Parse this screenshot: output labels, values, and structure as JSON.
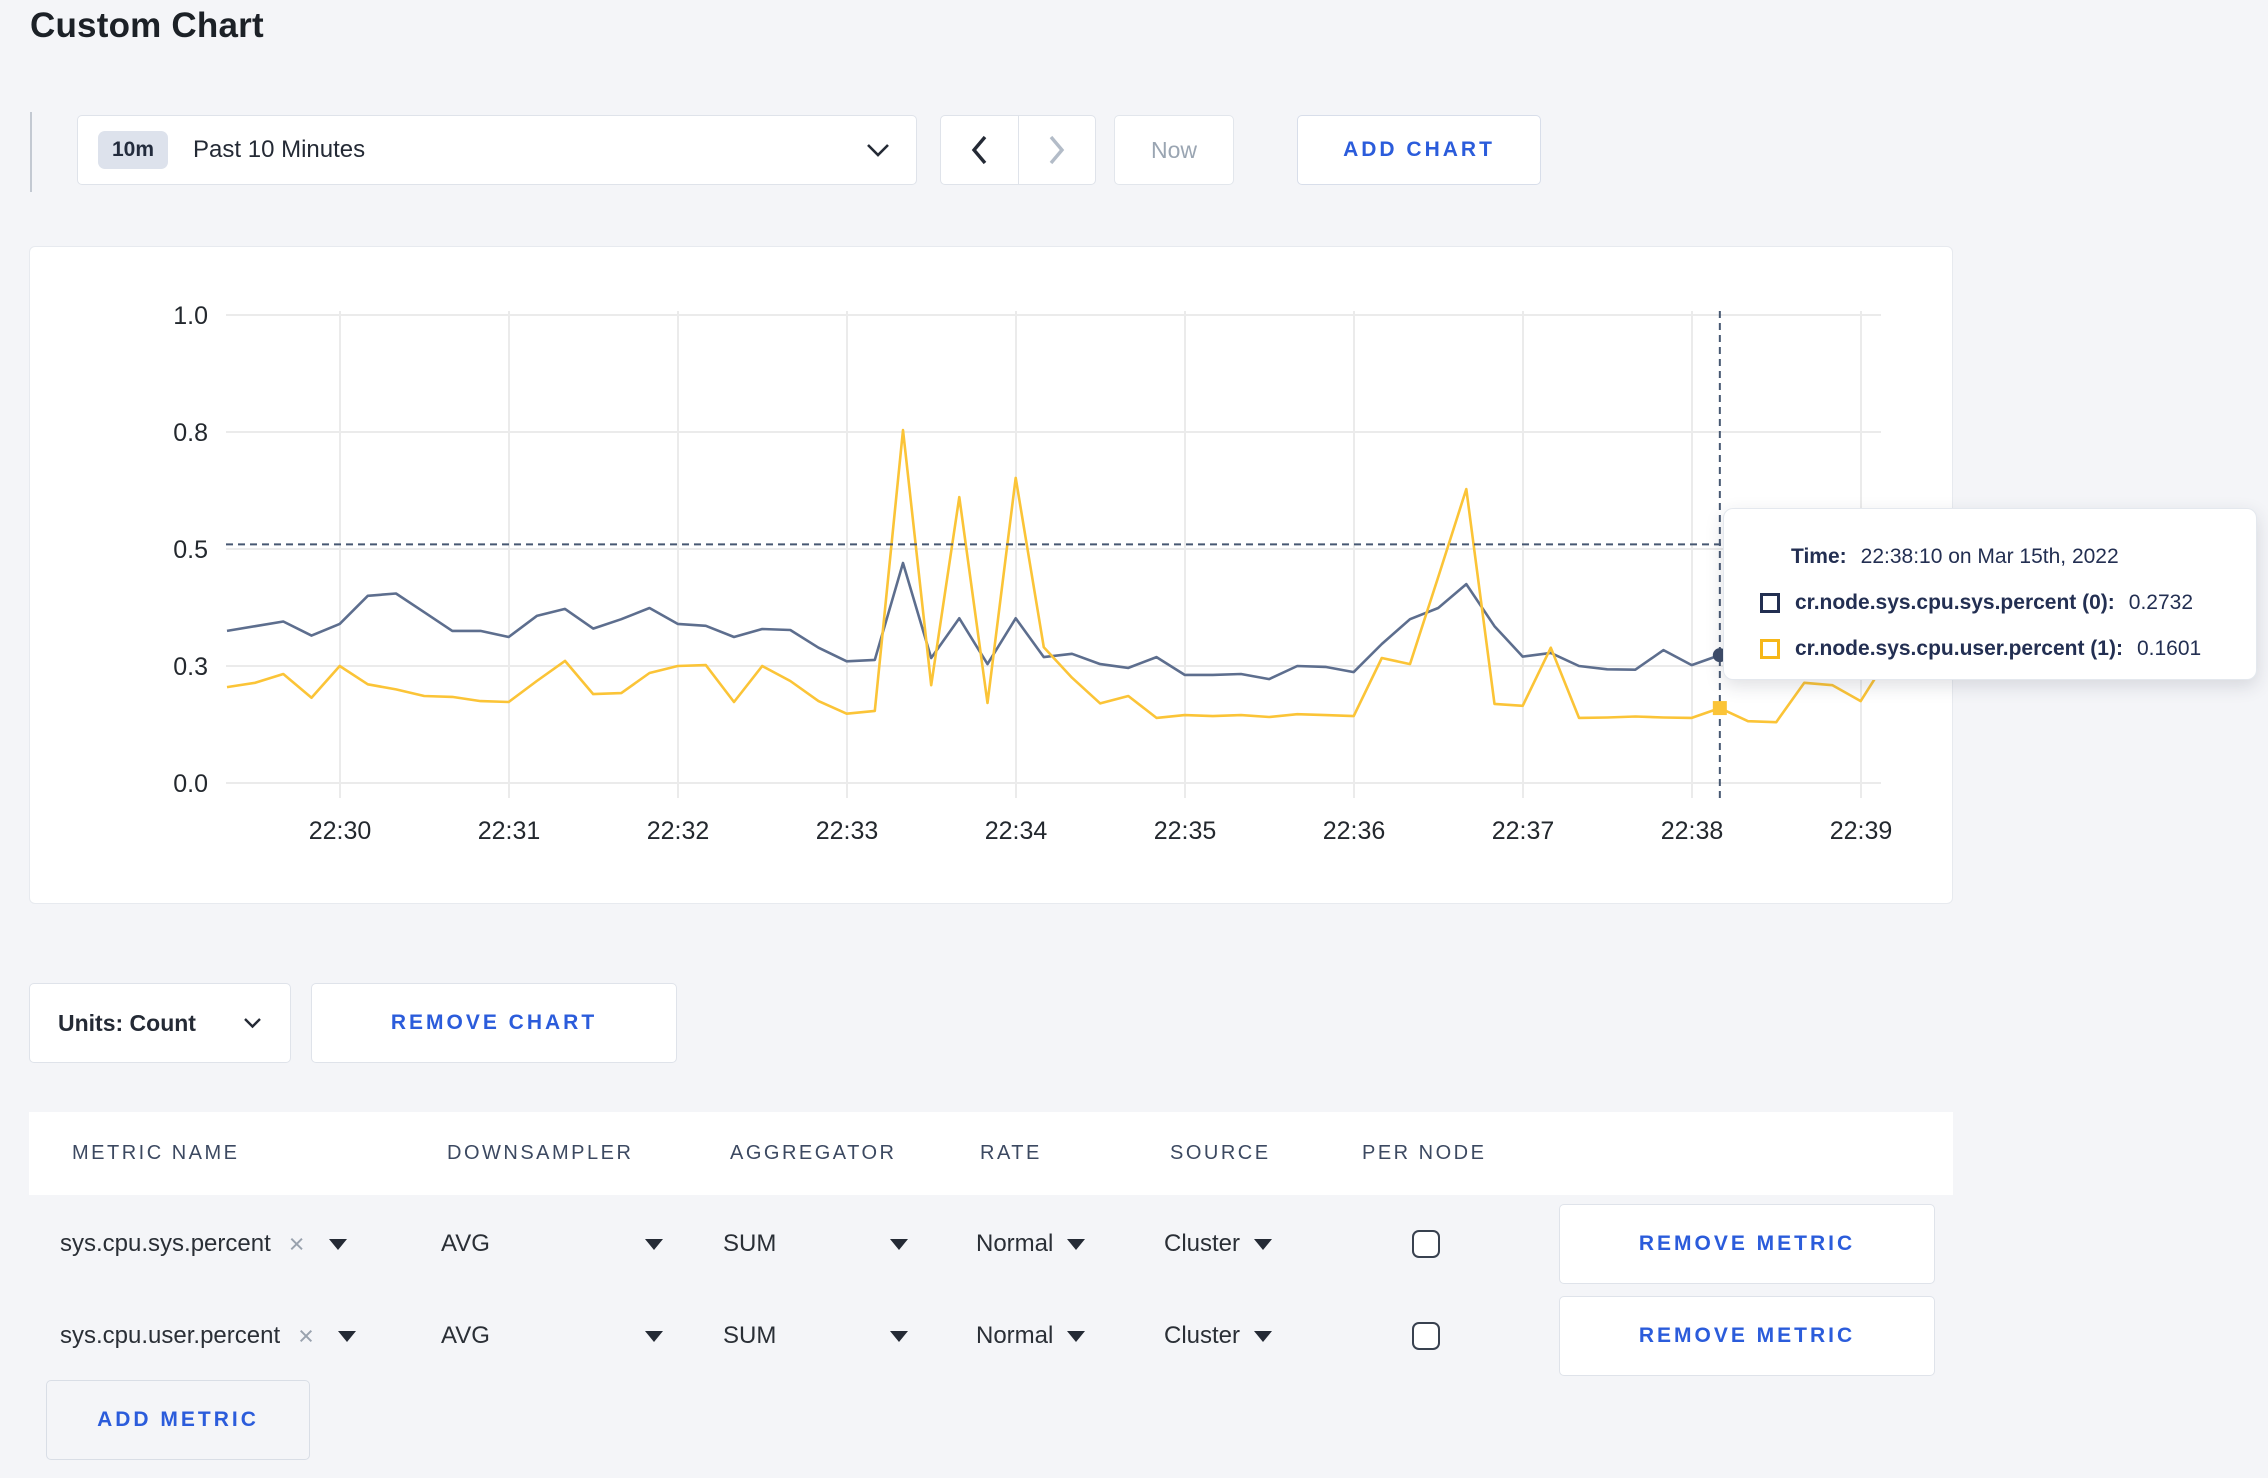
{
  "page": {
    "title": "Custom Chart"
  },
  "colors": {
    "accent_blue": "#2B5CDB",
    "page_background": "#F4F5F8",
    "grid_line": "#EBEBEB",
    "crosshair": "#475872"
  },
  "toolbar": {
    "range_badge": "10m",
    "range_label": "Past 10 Minutes",
    "now_label": "Now",
    "add_chart_label": "ADD CHART"
  },
  "chart": {
    "units_label": "Units: Count",
    "remove_chart_label": "REMOVE CHART"
  },
  "tooltip": {
    "time_label": "Time:",
    "time_value": "22:38:10 on Mar 15th, 2022",
    "rows": [
      {
        "label": "cr.node.sys.cpu.sys.percent (0):",
        "value": "0.2732",
        "color": "#222F51"
      },
      {
        "label": "cr.node.sys.cpu.user.percent (1):",
        "value": "0.1601",
        "color": "#F6B718"
      }
    ]
  },
  "metrics_table": {
    "headers": [
      "METRIC NAME",
      "DOWNSAMPLER",
      "AGGREGATOR",
      "RATE",
      "SOURCE",
      "PER NODE"
    ],
    "rows": [
      {
        "name": "sys.cpu.sys.percent",
        "downsampler": "AVG",
        "aggregator": "SUM",
        "rate": "Normal",
        "source": "Cluster",
        "per_node_checked": false,
        "remove_label": "REMOVE METRIC"
      },
      {
        "name": "sys.cpu.user.percent",
        "downsampler": "AVG",
        "aggregator": "SUM",
        "rate": "Normal",
        "source": "Cluster",
        "per_node_checked": false,
        "remove_label": "REMOVE METRIC"
      }
    ],
    "add_metric_label": "ADD METRIC"
  },
  "chart_data": {
    "type": "line",
    "title": "",
    "x_start": "22:29:20",
    "x_interval_seconds": 10,
    "x_tick_labels": [
      "22:30",
      "22:31",
      "22:32",
      "22:33",
      "22:34",
      "22:35",
      "22:36",
      "22:37",
      "22:38",
      "22:39"
    ],
    "ylim": [
      0,
      1
    ],
    "y_tick_values": [
      0,
      0.25,
      0.5,
      0.75,
      1
    ],
    "y_tick_labels": [
      "0.0",
      "0.3",
      "0.5",
      "0.8",
      "1.0"
    ],
    "grid": true,
    "legend_position": "tooltip",
    "series": [
      {
        "name": "cr.node.sys.cpu.sys.percent",
        "color": "#5D6E8E",
        "legend_color": "#222F51",
        "dot_color": "#3E4D6A",
        "values": [
          0.325,
          0.335,
          0.345,
          0.315,
          0.34,
          0.4,
          0.405,
          0.365,
          0.325,
          0.325,
          0.312,
          0.357,
          0.372,
          0.33,
          0.35,
          0.374,
          0.34,
          0.336,
          0.312,
          0.329,
          0.327,
          0.289,
          0.26,
          0.263,
          0.47,
          0.267,
          0.352,
          0.254,
          0.352,
          0.269,
          0.276,
          0.254,
          0.246,
          0.269,
          0.231,
          0.231,
          0.233,
          0.222,
          0.25,
          0.248,
          0.237,
          0.297,
          0.35,
          0.374,
          0.425,
          0.335,
          0.27,
          0.278,
          0.25,
          0.243,
          0.242,
          0.284,
          0.252,
          0.2732,
          0.3,
          0.295,
          0.29,
          0.3,
          0.295,
          0.3
        ]
      },
      {
        "name": "cr.node.sys.cpu.user.percent",
        "color": "#FBC437",
        "legend_color": "#F6B718",
        "dot_color": "#FBC437",
        "values": [
          0.205,
          0.214,
          0.233,
          0.182,
          0.25,
          0.211,
          0.2,
          0.186,
          0.184,
          0.175,
          0.173,
          0.218,
          0.261,
          0.19,
          0.192,
          0.235,
          0.25,
          0.252,
          0.173,
          0.25,
          0.218,
          0.175,
          0.148,
          0.154,
          0.754,
          0.209,
          0.611,
          0.171,
          0.652,
          0.29,
          0.225,
          0.17,
          0.186,
          0.139,
          0.145,
          0.143,
          0.145,
          0.141,
          0.147,
          0.145,
          0.143,
          0.267,
          0.254,
          0.44,
          0.628,
          0.169,
          0.165,
          0.289,
          0.139,
          0.14,
          0.142,
          0.14,
          0.139,
          0.1601,
          0.132,
          0.13,
          0.214,
          0.209,
          0.175,
          0.27
        ]
      }
    ],
    "crosshair": {
      "index": 53,
      "time": "22:38:10",
      "hline_value": 0.51,
      "sys_value": 0.2732,
      "user_value": 0.1601
    }
  }
}
